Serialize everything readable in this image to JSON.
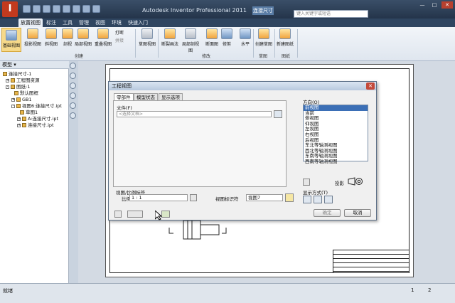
{
  "app": {
    "logo": "I",
    "window_title": "Autodesk Inventor Professional 2011",
    "document_tab": "连接尺寸",
    "search_placeholder": "键入关键字或短语",
    "min": "—",
    "max": "□",
    "close": "✕"
  },
  "menu": {
    "items": [
      "放置视图",
      "标注",
      "工具",
      "管理",
      "视图",
      "环境",
      "快速入门"
    ]
  },
  "ribbon": {
    "buttons": [
      "基础视图",
      "投影视图",
      "斜视图",
      "剖视",
      "局部视图",
      "重叠视图",
      "草图视图",
      "断裂画法",
      "局部剖视图",
      "断面图",
      "修剪",
      "水平",
      "创建草图",
      "新建图纸"
    ],
    "small_buttons": [
      "打断",
      "拼接"
    ],
    "groups": [
      "创建",
      "修改",
      "草图",
      "图纸"
    ]
  },
  "browser": {
    "header": "模型 ▾",
    "items": [
      "连接尺寸-1",
      "工程图资源",
      "图纸:1",
      "默认图框",
      "GB1",
      "视图6:连接尺寸.ipt",
      "草图1",
      "A:连接尺寸.ipt",
      "连接尺寸.ipt"
    ]
  },
  "dialog": {
    "title": "工程视图",
    "close": "✕",
    "tabs": [
      "零部件",
      "模型状态",
      "显示选项"
    ],
    "file_label": "文件(F)",
    "file_placeholder": "<选择文档>",
    "orientation_label": "方向(O)",
    "orientations": [
      "前视图",
      "当前",
      "俯视图",
      "仰视图",
      "左视图",
      "右视图",
      "后视图",
      "东北等轴测视图",
      "西北等轴测视图",
      "东南等轴测视图",
      "西南等轴测视图"
    ],
    "projection_label": "投影",
    "scale_section_label": "视图/比例标签",
    "scale_label": "比例",
    "scale_value": "1 : 1",
    "view_id_label": "视图标识符",
    "view_id_value": "视图7",
    "display_label": "显示方式(T)",
    "ok": "确定",
    "cancel": "取消"
  },
  "status": {
    "text": "就绪",
    "page_numbers": [
      "1",
      "2"
    ]
  }
}
